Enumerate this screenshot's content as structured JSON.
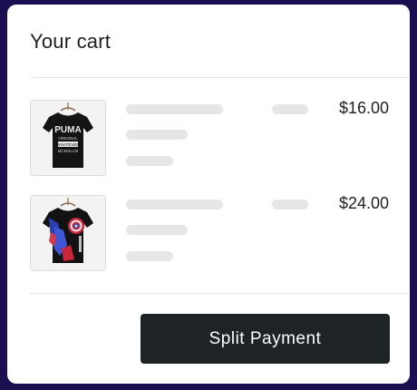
{
  "cart": {
    "title": "Your cart",
    "items": [
      {
        "price": "$16.00",
        "product_image": "black-puma-tshirt-image",
        "print_lines": [
          "PUMA",
          "ORIGINAL",
          "WHATEVER",
          "MCMXLVIII"
        ]
      },
      {
        "price": "$24.00",
        "product_image": "captain-america-tshirt-image",
        "print_lines": []
      }
    ]
  },
  "actions": {
    "split_payment_label": "Split Payment"
  },
  "colors": {
    "background": "#1b0f52",
    "card": "#ffffff",
    "button": "#1e2326",
    "skeleton": "#e6e6e6"
  }
}
